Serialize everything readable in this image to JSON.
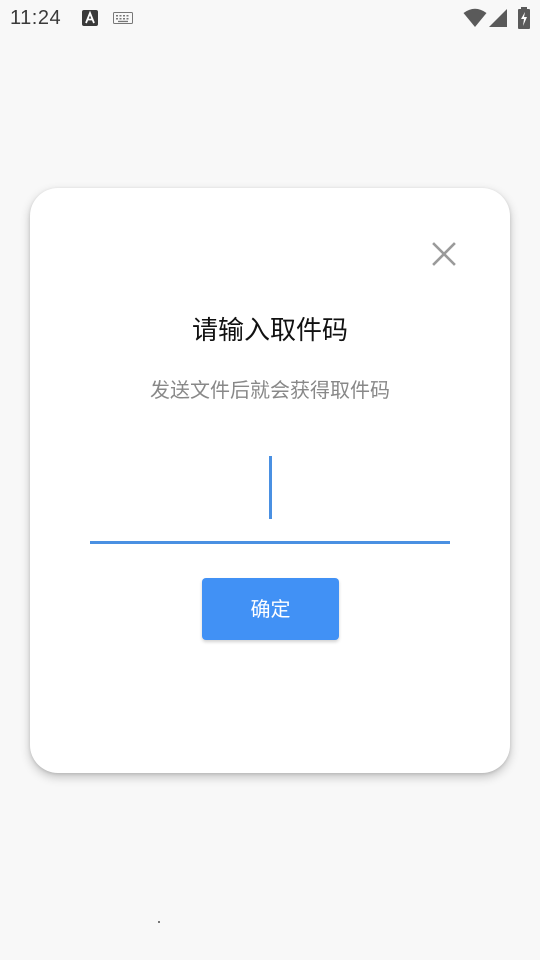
{
  "status_bar": {
    "time": "11:24",
    "icons": [
      "a-notification-icon",
      "keyboard-icon",
      "wifi-icon",
      "signal-icon",
      "battery-charging-icon"
    ]
  },
  "dialog": {
    "title": "请输入取件码",
    "subtitle": "发送文件后就会获得取件码",
    "code_input": {
      "value": "",
      "placeholder": ""
    },
    "confirm_label": "确定",
    "close_icon": "close-icon"
  },
  "colors": {
    "accent": "#4191f5",
    "underline": "#4a90e2",
    "background": "#f8f8f8",
    "card": "#ffffff",
    "title_text": "#111111",
    "subtitle_text": "#888888"
  }
}
